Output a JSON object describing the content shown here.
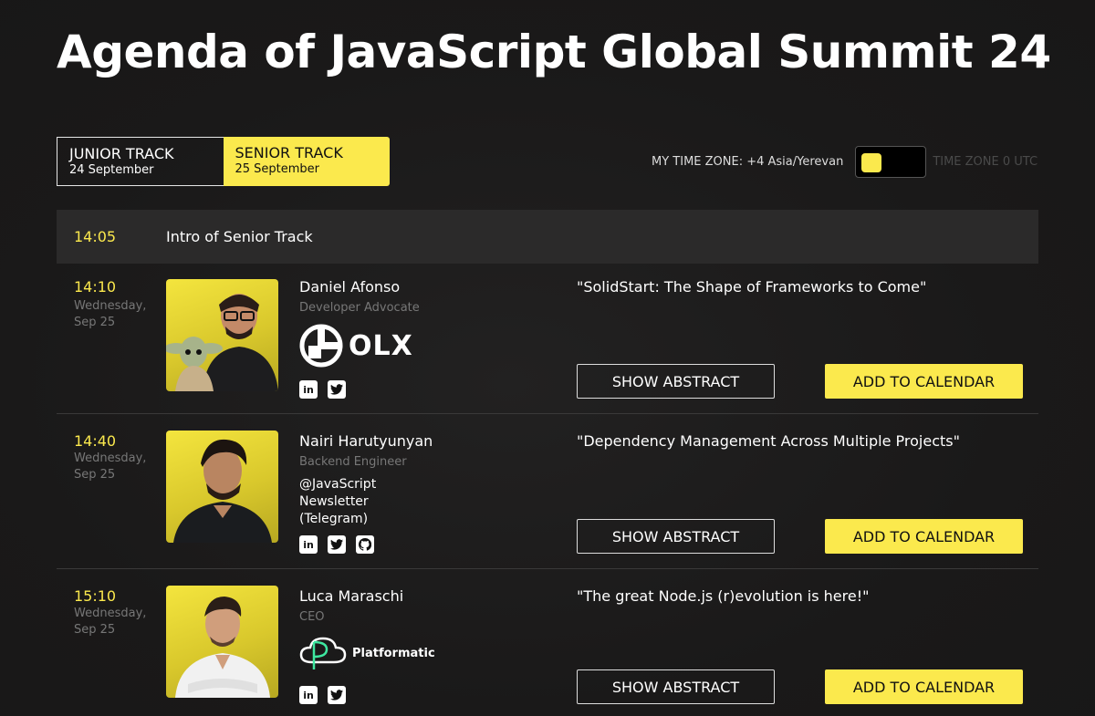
{
  "page": {
    "title": "Agenda of JavaScript Global Summit 24"
  },
  "tracks": [
    {
      "name": "JUNIOR TRACK",
      "date": "24 September",
      "active": false
    },
    {
      "name": "SENIOR TRACK",
      "date": "25 September",
      "active": true
    }
  ],
  "timezone": {
    "label": "MY TIME ZONE: +4 Asia/Yerevan",
    "alt_label": "TIME ZONE 0 UTC"
  },
  "colors": {
    "accent": "#fbe94d",
    "background": "#1b1a1a"
  },
  "intro": {
    "time": "14:05",
    "label": "Intro of Senior Track"
  },
  "sessions": [
    {
      "time": "14:10",
      "day": "Wednesday,",
      "date": "Sep 25",
      "speaker": "Daniel Afonso",
      "role": "Developer Advocate",
      "company_logo": "OLX",
      "talk": "\"SolidStart: The Shape of Frameworks to Come\"",
      "socials": [
        "linkedin-icon",
        "twitter-icon"
      ],
      "show_abstract": "SHOW ABSTRACT",
      "add_calendar": "ADD TO CALENDAR"
    },
    {
      "time": "14:40",
      "day": "Wednesday,",
      "date": "Sep 25",
      "speaker": "Nairi Harutyunyan",
      "role": "Backend Engineer",
      "company_lines": [
        "@JavaScript",
        "Newsletter",
        "(Telegram)"
      ],
      "talk": "\"Dependency Management Across Multiple Projects\"",
      "socials": [
        "linkedin-icon",
        "twitter-icon",
        "github-icon"
      ],
      "show_abstract": "SHOW ABSTRACT",
      "add_calendar": "ADD TO CALENDAR"
    },
    {
      "time": "15:10",
      "day": "Wednesday,",
      "date": "Sep 25",
      "speaker": "Luca Maraschi",
      "role": "CEO",
      "company_logo": "Platformatic",
      "talk": "\"The great Node.js (r)evolution is here!\"",
      "socials": [
        "linkedin-icon",
        "twitter-icon"
      ],
      "show_abstract": "SHOW ABSTRACT",
      "add_calendar": "ADD TO CALENDAR"
    }
  ]
}
